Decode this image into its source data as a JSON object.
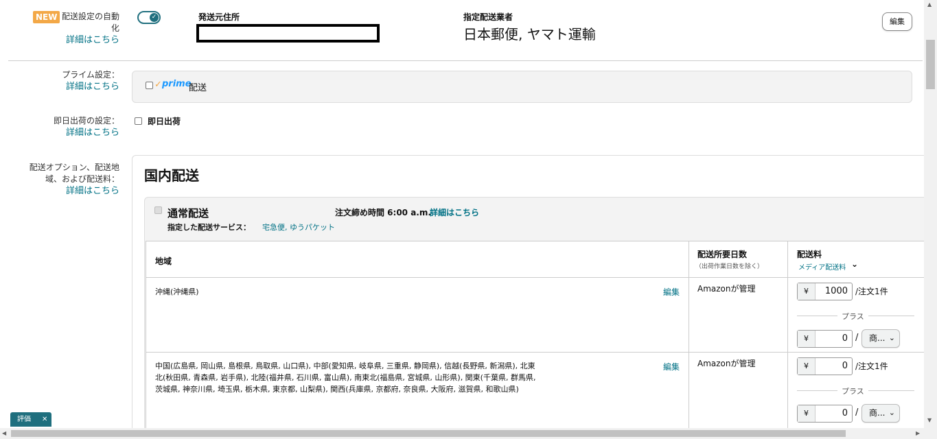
{
  "auto_setting": {
    "badge": "NEW",
    "label_line1": "配送設定の自動",
    "label_line2": "化",
    "link": "詳細はこちら",
    "toggle_check": "✓"
  },
  "origin": {
    "title": "発送元住所"
  },
  "carrier": {
    "title": "指定配送業者",
    "value": "日本郵便, ヤマト運輸"
  },
  "edit_button": "編集",
  "prime": {
    "label": "プライム設定：",
    "link": "詳細はこちら",
    "check_mark": "✓",
    "logo": "prime",
    "text": "配送"
  },
  "same_day": {
    "label": "即日出荷の設定：",
    "link": "詳細はこちら",
    "checkbox_label": "即日出荷"
  },
  "options": {
    "label_line1": "配送オプション、配送地",
    "label_line2": "域、および配送料：",
    "link": "詳細はこちら"
  },
  "domestic": {
    "title": "国内配送",
    "standard": {
      "title": "通常配送",
      "cutoff_label": "注文締め時間 6:00 a.m.",
      "cutoff_link": "詳細はこちら",
      "services_label": "指定した配送サービス：",
      "services_value": "宅急便, ゆうパケット"
    }
  },
  "table": {
    "headers": {
      "region": "地域",
      "days": "配送所要日数",
      "days_note": "（出荷作業日数を除く）",
      "fee": "配送料",
      "fee_dropdown": "メディア配送料"
    },
    "rows": [
      {
        "region": "沖縄(沖縄県)",
        "edit": "編集",
        "days": "Amazonが管理",
        "currency": "¥",
        "fee_per_order": "1000",
        "per_order_label": "/注文1件",
        "plus_label": "プラス",
        "fee_per_item": "0",
        "slash": "/",
        "unit_select": "商..."
      },
      {
        "region_line1": "中国(広島県, 岡山県, 島根県, 鳥取県, 山口県), 中部(愛知県, 岐阜県, 三重県, 静岡県), 信越(長野県, 新潟県), 北東",
        "region_line2": "北(秋田県, 青森県, 岩手県), 北陸(福井県, 石川県, 富山県), 南東北(福島県, 宮城県, 山形県), 関東(千葉県, 群馬県,",
        "region_line3": "茨城県, 神奈川県, 埼玉県, 栃木県, 東京都, 山梨県), 関西(兵庫県, 京都府, 奈良県, 大阪府, 滋賀県, 和歌山県)",
        "edit": "編集",
        "days": "Amazonが管理",
        "currency": "¥",
        "fee_per_order": "0",
        "per_order_label": "/注文1件",
        "plus_label": "プラス",
        "fee_per_item": "0",
        "slash": "/",
        "unit_select": "商..."
      }
    ]
  },
  "feedback_tab": {
    "label": "評価",
    "close": "✕"
  },
  "colors": {
    "link": "#007185",
    "badge": "#f3a847",
    "toggle": "#1f6f7e",
    "prime_blue": "#1a98ff"
  }
}
